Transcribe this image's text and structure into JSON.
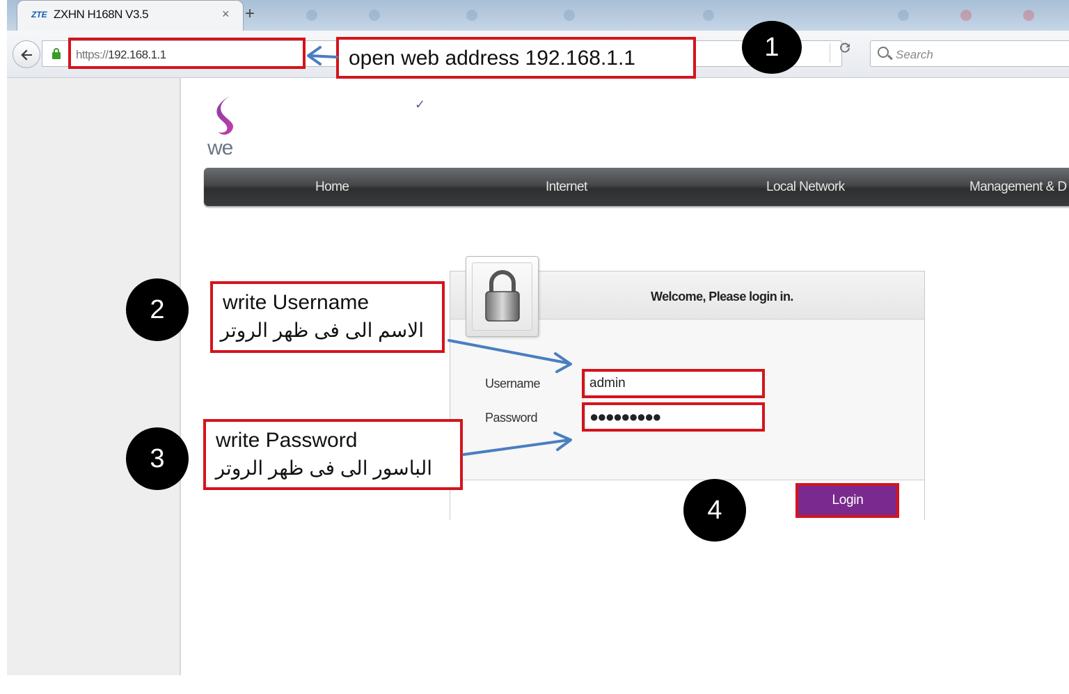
{
  "browser": {
    "tab": {
      "brand": "ZTE",
      "title": "ZXHN H168N V3.5",
      "close": "×"
    },
    "new_tab": "+",
    "url": {
      "scheme": "https://",
      "host": "192.168.1.1"
    },
    "reload_glyph": "⟳",
    "search_placeholder": "Search"
  },
  "logo": {
    "text": "we",
    "color_top": "#8a3ba8",
    "color_bottom": "#c23ea8"
  },
  "menu": {
    "items": [
      "Home",
      "Internet",
      "Local Network",
      "Management & D"
    ]
  },
  "login": {
    "title": "Welcome, Please login in.",
    "username_label": "Username",
    "password_label": "Password",
    "username_value": "admin",
    "password_value": "●●●●●●●●●",
    "button_label": "Login",
    "button_color": "#7a2a8e"
  },
  "annotations": {
    "step1": {
      "number": "1",
      "text": "open web address  192.168.1.1"
    },
    "step2": {
      "number": "2",
      "text_en": "write Username",
      "text_ar": "الاسم الى فى ظهر الروتر"
    },
    "step3": {
      "number": "3",
      "text_en": "write  Password",
      "text_ar": "الباسور الى فى ظهر الروتر"
    },
    "step4": {
      "number": "4"
    },
    "highlight_color": "#d4141c",
    "arrow_color": "#4a7ec0"
  }
}
